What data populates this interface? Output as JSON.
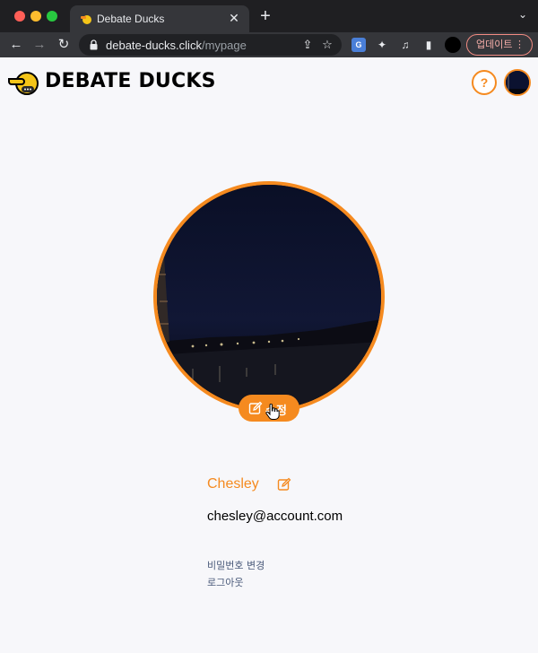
{
  "browser": {
    "tab_title": "Debate Ducks",
    "close_glyph": "✕",
    "new_tab_glyph": "+",
    "tab_menu_glyph": "⌄",
    "url_host": "debate-ducks.click",
    "url_path": "/mypage",
    "translate_badge": "G",
    "update_label": "업데이트",
    "update_menu_glyph": "⋮"
  },
  "header": {
    "brand": "DEBATE DUCKS",
    "help_label": "?"
  },
  "profile": {
    "edit_photo_label": "수정",
    "username": "Chesley",
    "email": "chesley@account.com",
    "links": {
      "change_password": "비밀번호 변경",
      "logout": "로그아웃"
    }
  },
  "colors": {
    "accent": "#f58a1f",
    "page_bg": "#f7f7fa",
    "link": "#4a5a7a"
  },
  "icons": [
    "duck-logo-icon",
    "help-icon",
    "edit-icon",
    "lock-icon",
    "share-icon",
    "star-icon",
    "puzzle-icon",
    "reload-icon"
  ]
}
